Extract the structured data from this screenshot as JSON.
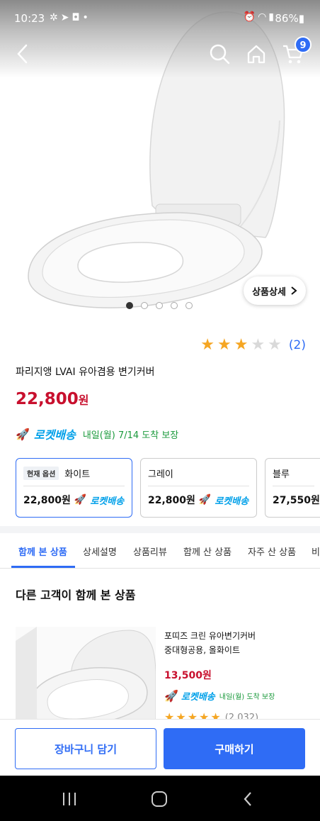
{
  "status_bar": {
    "time": "10:23",
    "left_icons": [
      "settings-gear-icon",
      "telegram-icon",
      "voicemail-icon",
      "dot-icon"
    ],
    "right_icons": [
      "alarm-icon",
      "wifi-icon",
      "signal-icon"
    ],
    "battery": "86%"
  },
  "nav": {
    "cart_count": "9"
  },
  "gallery": {
    "detail_button": "상품상세",
    "slides": 5,
    "active_slide": 1
  },
  "product": {
    "rating_stars": 3,
    "rating_max": 5,
    "rating_count": "(2)",
    "title": "파리지앵 LVAI 유아겸용 변기커버",
    "price": "22,800",
    "price_unit": "원",
    "rocket_label": "로켓배송",
    "delivery": "내일(월) 7/14 도착 보장"
  },
  "options": [
    {
      "current_tag": "현재 옵션",
      "name": "화이트",
      "price": "22,800원",
      "rocket": "로켓배송",
      "selected": true
    },
    {
      "current_tag": "",
      "name": "그레이",
      "price": "22,800원",
      "rocket": "로켓배송",
      "selected": false
    },
    {
      "current_tag": "",
      "name": "블루",
      "price": "27,550원",
      "rocket": "",
      "selected": false
    }
  ],
  "tabs": [
    "함께 본 상품",
    "상세설명",
    "상품리뷰",
    "함께 산 상품",
    "자주 산 상품",
    "비"
  ],
  "section": {
    "title": "다른 고객이 함께 본 상품"
  },
  "recommendation": {
    "name_line1": "포띠즈 크린 유아변기커버",
    "name_line2": "중대형공용, 올화이트",
    "price": "13,500원",
    "rocket": "로켓배송",
    "delivery": "내일(월) 도착 보장",
    "rating_count": "(2,032)"
  },
  "actions": {
    "cart_button": "장바구니 담기",
    "buy_button": "구매하기"
  },
  "colors": {
    "accent": "#2f6cf5",
    "price_red": "#c8102e",
    "rocket_blue": "#00a0e9",
    "delivery_green": "#1b9a3c",
    "star": "#f5a623"
  }
}
